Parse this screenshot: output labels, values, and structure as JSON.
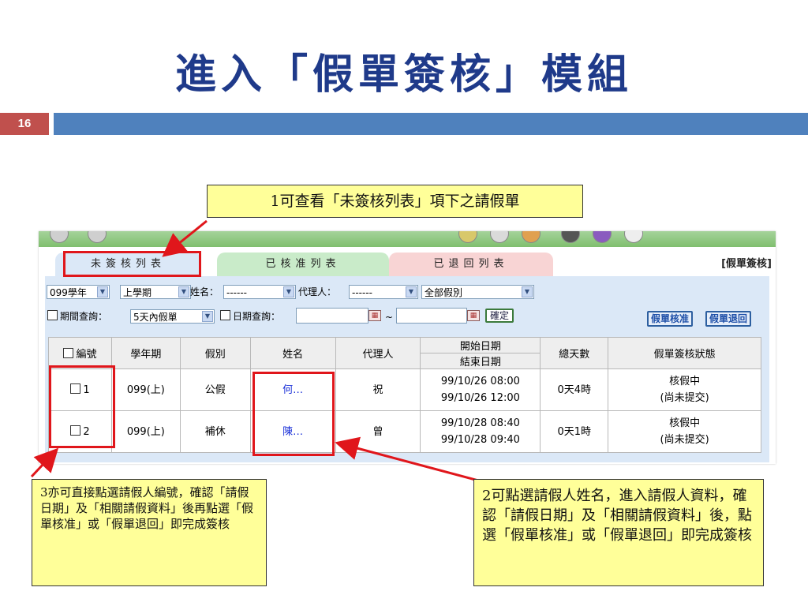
{
  "slide": {
    "title": "進入「假單簽核」模組",
    "page_number": "16"
  },
  "callouts": {
    "c1": "1可查看「未簽核列表」項下之請假單",
    "c2": "2可點選請假人姓名，進入請假人資料，確認「請假日期」及「相關請假資料」後，點選「假單核准」或「假單退回」即完成簽核",
    "c3": "3亦可直接點選請假人編號，確認「請假日期」及「相關請假資料」後再點選「假單核准」或「假單退回」即完成簽核"
  },
  "app": {
    "tabs": {
      "pending": "未簽核列表",
      "approved": "已核准列表",
      "returned": "已退回列表"
    },
    "module_label": "[假單簽核]",
    "filters": {
      "year_value": "099學年",
      "term_value": "上學期",
      "name_label": "姓名：",
      "name_value": "------",
      "agent_label": "代理人：",
      "agent_value": "------",
      "leave_type_value": "全部假別",
      "period_query_label": "期間查詢：",
      "period_query_value": "5天內假單",
      "date_query_label": "日期查詢：",
      "date_separator": "~",
      "confirm_label": "確定",
      "approve_label": "假單核准",
      "return_label": "假單退回"
    },
    "table": {
      "headers": {
        "no": "編號",
        "term": "學年期",
        "type": "假別",
        "name": "姓名",
        "agent": "代理人",
        "start": "開始日期",
        "end": "結束日期",
        "total_days": "總天數",
        "status": "假單簽核狀態"
      },
      "rows": [
        {
          "no": "1",
          "term": "099(上)",
          "type": "公假",
          "name": "何…",
          "agent": "祝",
          "start": "99/10/26 08:00",
          "end": "99/10/26 12:00",
          "total": "0天4時",
          "status": "核假中",
          "status_sub": "(尚未提交)"
        },
        {
          "no": "2",
          "term": "099(上)",
          "type": "補休",
          "name": "陳…",
          "agent": "曾",
          "start": "99/10/28 08:40",
          "end": "99/10/28 09:40",
          "total": "0天1時",
          "status": "核假中",
          "status_sub": "(尚未提交)"
        }
      ]
    }
  },
  "colors": {
    "title": "#1f3a8a",
    "accent_red": "#e0161b",
    "callout_fill": "#ffff99",
    "title_bar": "#4f81bd",
    "page_badge": "#c0504d"
  },
  "icons": [
    "checkbox-icon",
    "calendar-icon",
    "dropdown-arrow-icon",
    "arrow-icon"
  ]
}
